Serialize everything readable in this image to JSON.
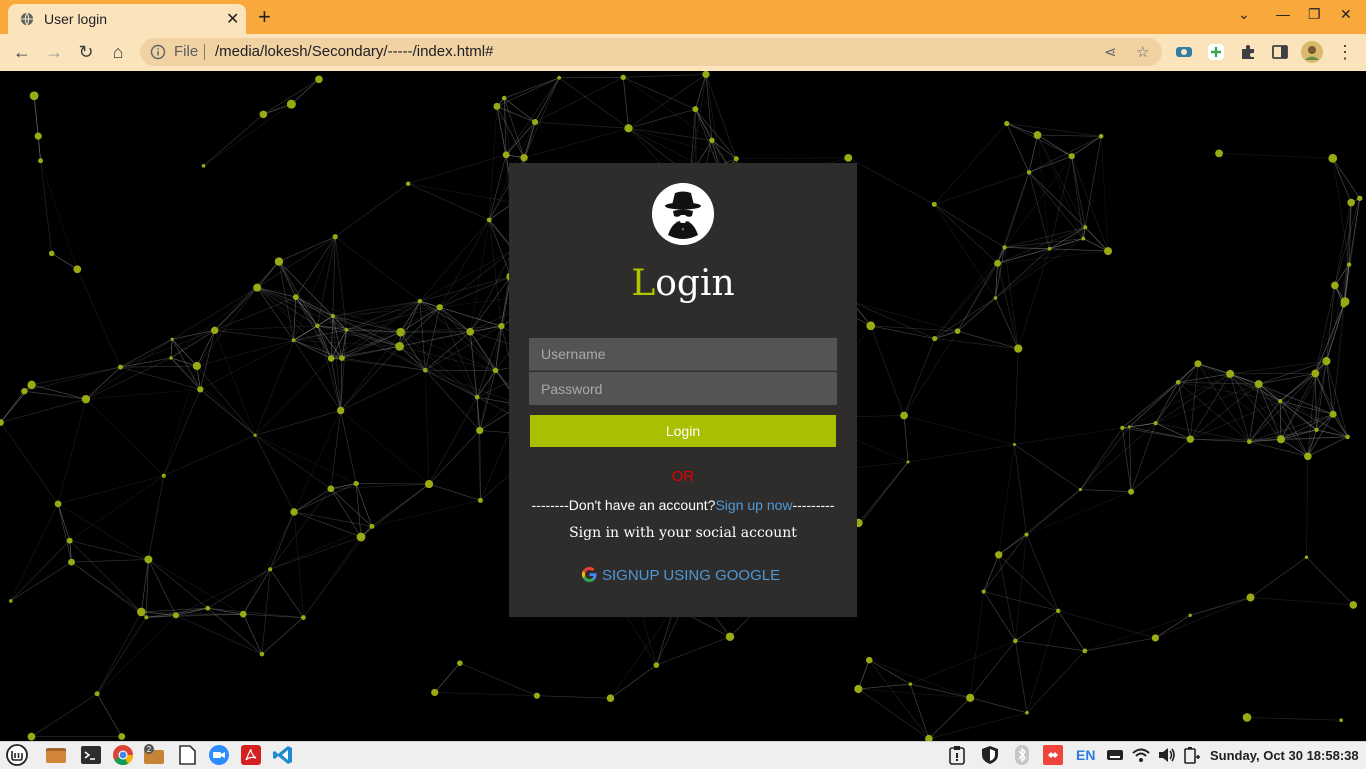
{
  "browser": {
    "tab_title": "User login",
    "new_tab": "+",
    "tab_close": "✕",
    "omnibox_scheme": "File",
    "url": "/media/lokesh/Secondary/-----/index.html#"
  },
  "login": {
    "title_first_letter": "L",
    "title_rest": "ogin",
    "username_placeholder": "Username",
    "password_placeholder": "Password",
    "login_button": "Login",
    "or_text": "OR",
    "signup_prefix": "--------Don't have an account?",
    "signup_link": "Sign up now",
    "signup_suffix": "---------",
    "social_text": "Sign in with your social account",
    "google_button": "SIGNUP USING GOOGLE"
  },
  "taskbar": {
    "keyboard_layout": "EN",
    "clock": "Sunday, Oct 30 18:58:38",
    "file_manager_badge": "2"
  },
  "colors": {
    "accent": "#a9c000",
    "link": "#4f98d7",
    "or": "#e20000",
    "card": "#2e2d2b",
    "tabbar": "#f9a83c"
  }
}
